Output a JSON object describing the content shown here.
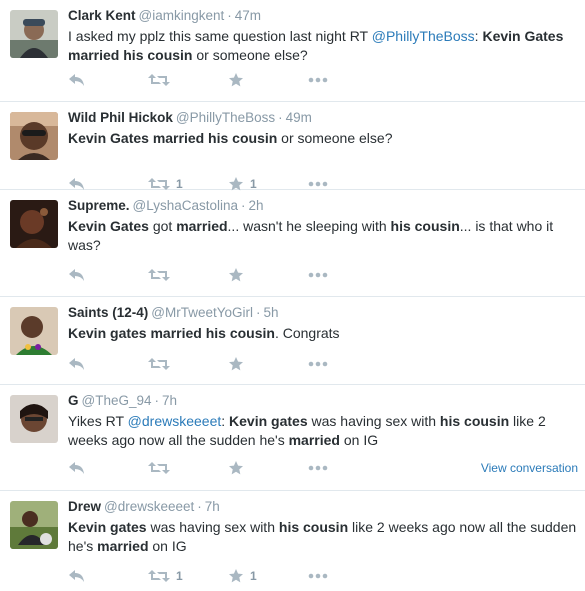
{
  "colors": {
    "name": "#292f33",
    "meta": "#8899a6",
    "link": "#2b7bb9",
    "icon": "#aab8c2",
    "divider": "#e1e8ed"
  },
  "icons": [
    "reply-icon",
    "retweet-icon",
    "favorite-icon",
    "more-icon"
  ],
  "tweets": [
    {
      "fullname": "Clark Kent",
      "handle": "@iamkingkent",
      "time": "47m",
      "segments": [
        {
          "t": "I asked my pplz this same question last night RT ",
          "s": "n"
        },
        {
          "t": "@PhillyTheBoss",
          "s": "m"
        },
        {
          "t": ": ",
          "s": "n"
        },
        {
          "t": "Kevin Gates married his cousin",
          "s": "b"
        },
        {
          "t": " or someone else?",
          "s": "n"
        }
      ],
      "retweets": "",
      "favorites": "",
      "view_conversation": ""
    },
    {
      "fullname": "Wild Phil Hickok",
      "handle": "@PhillyTheBoss",
      "time": "49m",
      "segments": [
        {
          "t": "Kevin Gates married his cousin",
          "s": "b"
        },
        {
          "t": " or someone else?",
          "s": "n"
        }
      ],
      "retweets": "1",
      "favorites": "1",
      "view_conversation": ""
    },
    {
      "fullname": "Supreme.",
      "handle": "@LyshaCastolina",
      "time": "2h",
      "segments": [
        {
          "t": "Kevin Gates",
          "s": "b"
        },
        {
          "t": " got ",
          "s": "n"
        },
        {
          "t": "married",
          "s": "b"
        },
        {
          "t": "... wasn't he sleeping with ",
          "s": "n"
        },
        {
          "t": "his cousin",
          "s": "b"
        },
        {
          "t": "... is that who it was?",
          "s": "n"
        }
      ],
      "retweets": "",
      "favorites": "",
      "view_conversation": ""
    },
    {
      "fullname": "Saints (12-4)",
      "handle": "@MrTweetYoGirl",
      "time": "5h",
      "segments": [
        {
          "t": "Kevin gates married his cousin",
          "s": "b"
        },
        {
          "t": ". Congrats",
          "s": "n"
        }
      ],
      "retweets": "",
      "favorites": "",
      "view_conversation": ""
    },
    {
      "fullname": "G",
      "handle": "@TheG_94",
      "time": "7h",
      "segments": [
        {
          "t": "Yikes RT ",
          "s": "n"
        },
        {
          "t": "@drewskeeeet",
          "s": "m"
        },
        {
          "t": ": ",
          "s": "n"
        },
        {
          "t": "Kevin gates",
          "s": "b"
        },
        {
          "t": " was having sex with ",
          "s": "n"
        },
        {
          "t": "his cousin",
          "s": "b"
        },
        {
          "t": " like 2 weeks ago now all the sudden he's ",
          "s": "n"
        },
        {
          "t": "married",
          "s": "b"
        },
        {
          "t": " on IG",
          "s": "n"
        }
      ],
      "retweets": "",
      "favorites": "",
      "view_conversation": "View conversation"
    },
    {
      "fullname": "Drew",
      "handle": "@drewskeeeet",
      "time": "7h",
      "segments": [
        {
          "t": "Kevin gates",
          "s": "b"
        },
        {
          "t": " was having sex with ",
          "s": "n"
        },
        {
          "t": "his cousin",
          "s": "b"
        },
        {
          "t": " like 2 weeks ago now all the sudden he's ",
          "s": "n"
        },
        {
          "t": "married",
          "s": "b"
        },
        {
          "t": " on IG",
          "s": "n"
        }
      ],
      "retweets": "1",
      "favorites": "1",
      "view_conversation": ""
    }
  ]
}
